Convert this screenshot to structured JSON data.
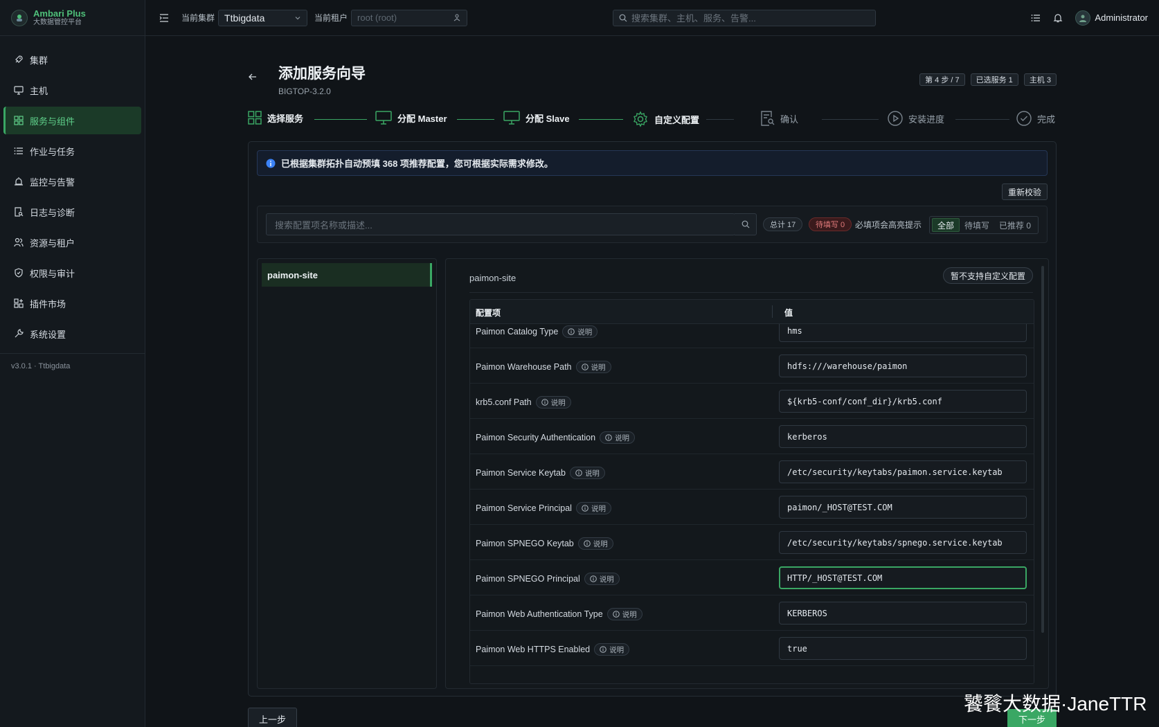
{
  "brand": {
    "name": "Ambari Plus",
    "subtitle": "大数据管控平台"
  },
  "sidebar": {
    "items": [
      {
        "label": "集群",
        "icon": "rocket-icon"
      },
      {
        "label": "主机",
        "icon": "monitor-icon"
      },
      {
        "label": "服务与组件",
        "icon": "grid-icon",
        "active": true
      },
      {
        "label": "作业与任务",
        "icon": "list-icon"
      },
      {
        "label": "监控与告警",
        "icon": "alarm-icon"
      },
      {
        "label": "日志与诊断",
        "icon": "log-search-icon"
      },
      {
        "label": "资源与租户",
        "icon": "users-icon"
      },
      {
        "label": "权限与审计",
        "icon": "shield-icon"
      },
      {
        "label": "插件市场",
        "icon": "apps-icon"
      },
      {
        "label": "系统设置",
        "icon": "wrench-icon"
      }
    ],
    "version": "v3.0.1 · Ttbigdata"
  },
  "topbar": {
    "cluster_label": "当前集群",
    "cluster_value": "Ttbigdata",
    "tenant_label": "当前租户",
    "tenant_placeholder": "root (root)",
    "search_placeholder": "搜索集群、主机、服务、告警...",
    "user_name": "Administrator"
  },
  "page": {
    "title": "添加服务向导",
    "subtitle": "BIGTOP-3.2.0",
    "badges": [
      "第 4 步 / 7",
      "已选服务 1",
      "主机 3"
    ]
  },
  "steps": [
    {
      "label": "选择服务",
      "state": "done",
      "icon": "grid-icon"
    },
    {
      "label": "分配 Master",
      "state": "done",
      "icon": "monitor-icon"
    },
    {
      "label": "分配 Slave",
      "state": "done",
      "icon": "monitor-icon"
    },
    {
      "label": "自定义配置",
      "state": "current",
      "icon": "gear-icon"
    },
    {
      "label": "确认",
      "state": "pending",
      "icon": "document-search-icon"
    },
    {
      "label": "安装进度",
      "state": "pending",
      "icon": "play-circle-icon"
    },
    {
      "label": "完成",
      "state": "pending",
      "icon": "check-circle-icon"
    }
  ],
  "alert": {
    "text": "已根据集群拓扑自动预填 368 项推荐配置，您可根据实际需求修改。"
  },
  "recheck_label": "重新校验",
  "filter": {
    "search_placeholder": "搜索配置项名称或描述...",
    "total": "总计 17",
    "todo": "待填写 0",
    "hint": "必填项会高亮提示",
    "segments": [
      "全部",
      "待填写",
      "已推荐 0"
    ],
    "active_segment": "全部"
  },
  "tree": {
    "selected": "paimon-site"
  },
  "config": {
    "title": "paimon-site",
    "note": "暂不支持自定义配置",
    "col_key": "配置项",
    "col_value": "值",
    "help_label": "说明",
    "rows": [
      {
        "key": "Paimon Catalog Type",
        "value": "hms"
      },
      {
        "key": "Paimon Warehouse Path",
        "value": "hdfs:///warehouse/paimon"
      },
      {
        "key": "krb5.conf Path",
        "value": "${krb5-conf/conf_dir}/krb5.conf"
      },
      {
        "key": "Paimon Security Authentication",
        "value": "kerberos"
      },
      {
        "key": "Paimon Service Keytab",
        "value": "/etc/security/keytabs/paimon.service.keytab"
      },
      {
        "key": "Paimon Service Principal",
        "value": "paimon/_HOST@TEST.COM"
      },
      {
        "key": "Paimon SPNEGO Keytab",
        "value": "/etc/security/keytabs/spnego.service.keytab"
      },
      {
        "key": "Paimon SPNEGO Principal",
        "value": "HTTP/_HOST@TEST.COM",
        "focused": true
      },
      {
        "key": "Paimon Web Authentication Type",
        "value": "KERBEROS"
      },
      {
        "key": "Paimon Web HTTPS Enabled",
        "value": "true"
      }
    ]
  },
  "footer": {
    "prev": "上一步",
    "next": "下一步"
  },
  "watermark": "饕餮大数据·JaneTTR",
  "colors": {
    "accent": "#3aa764",
    "background": "#101418",
    "danger": "#e07a7a",
    "info": "#3b82f6"
  }
}
